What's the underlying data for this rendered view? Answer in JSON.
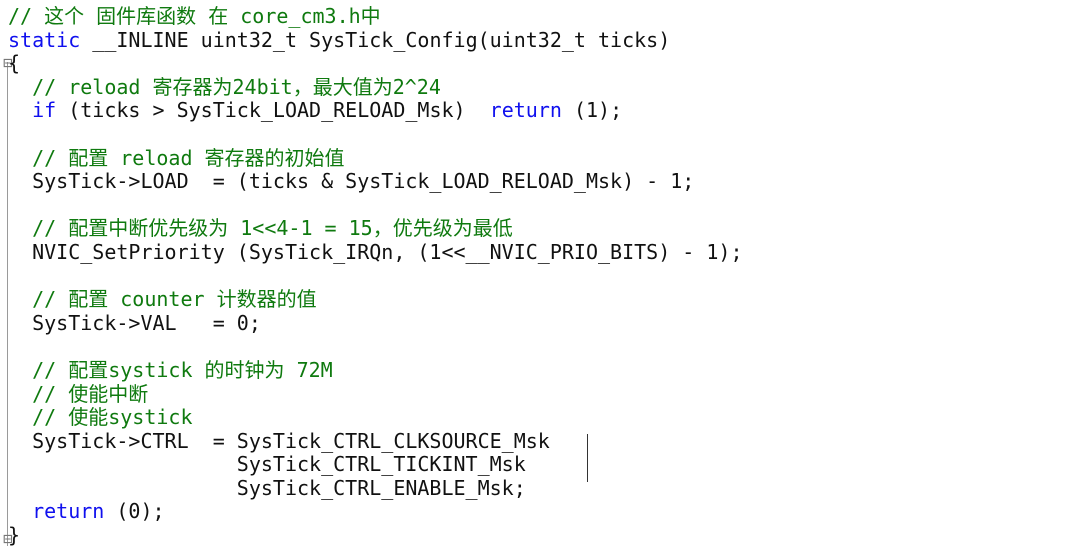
{
  "editor": {
    "lines": [
      {
        "parts": [
          {
            "kind": "comment",
            "text": "// 这个 固件库函数 在 core_cm3.h中"
          }
        ]
      },
      {
        "parts": [
          {
            "kind": "keyword",
            "text": "static"
          },
          {
            "kind": "text",
            "text": " __INLINE uint32_t SysTick_Config(uint32_t ticks)"
          }
        ]
      },
      {
        "parts": [
          {
            "kind": "text",
            "text": "{"
          }
        ]
      },
      {
        "parts": [
          {
            "kind": "comment",
            "text": "  // reload 寄存器为24bit，最大值为2^24"
          }
        ]
      },
      {
        "parts": [
          {
            "kind": "keyword",
            "text": "  if"
          },
          {
            "kind": "text",
            "text": " (ticks > SysTick_LOAD_RELOAD_Msk)  "
          },
          {
            "kind": "keyword",
            "text": "return"
          },
          {
            "kind": "text",
            "text": " (1);"
          }
        ]
      },
      {
        "parts": [
          {
            "kind": "text",
            "text": ""
          }
        ]
      },
      {
        "parts": [
          {
            "kind": "comment",
            "text": "  // 配置 reload 寄存器的初始值"
          }
        ]
      },
      {
        "parts": [
          {
            "kind": "text",
            "text": "  SysTick->LOAD  = (ticks & SysTick_LOAD_RELOAD_Msk) - 1;"
          }
        ]
      },
      {
        "parts": [
          {
            "kind": "text",
            "text": ""
          }
        ]
      },
      {
        "parts": [
          {
            "kind": "comment",
            "text": "  // 配置中断优先级为 1<<4-1 = 15，优先级为最低"
          }
        ]
      },
      {
        "parts": [
          {
            "kind": "text",
            "text": "  NVIC_SetPriority (SysTick_IRQn, (1<<__NVIC_PRIO_BITS) - 1);"
          }
        ]
      },
      {
        "parts": [
          {
            "kind": "text",
            "text": ""
          }
        ]
      },
      {
        "parts": [
          {
            "kind": "comment",
            "text": "  // 配置 counter 计数器的值"
          }
        ]
      },
      {
        "parts": [
          {
            "kind": "text",
            "text": "  SysTick->VAL   = 0;"
          }
        ]
      },
      {
        "parts": [
          {
            "kind": "text",
            "text": ""
          }
        ]
      },
      {
        "parts": [
          {
            "kind": "comment",
            "text": "  // 配置systick 的时钟为 72M"
          }
        ]
      },
      {
        "parts": [
          {
            "kind": "comment",
            "text": "  // 使能中断"
          }
        ]
      },
      {
        "parts": [
          {
            "kind": "comment",
            "text": "  // 使能systick"
          }
        ]
      },
      {
        "parts": [
          {
            "kind": "text",
            "text": "  SysTick->CTRL  = SysTick_CTRL_CLKSOURCE_Msk"
          }
        ]
      },
      {
        "parts": [
          {
            "kind": "text",
            "text": "                   SysTick_CTRL_TICKINT_Msk"
          }
        ]
      },
      {
        "parts": [
          {
            "kind": "text",
            "text": "                   SysTick_CTRL_ENABLE_Msk;"
          }
        ]
      },
      {
        "parts": [
          {
            "kind": "keyword",
            "text": "  return"
          },
          {
            "kind": "text",
            "text": " (0);"
          }
        ]
      },
      {
        "parts": [
          {
            "kind": "text",
            "text": "}"
          }
        ]
      }
    ]
  },
  "colors": {
    "comment": "#0f7a0f",
    "keyword": "#1010ee",
    "text": "#111111",
    "background": "#ffffff"
  },
  "icons": {
    "fold_open": "minus-box-icon",
    "fold_close": "minus-box-icon"
  }
}
